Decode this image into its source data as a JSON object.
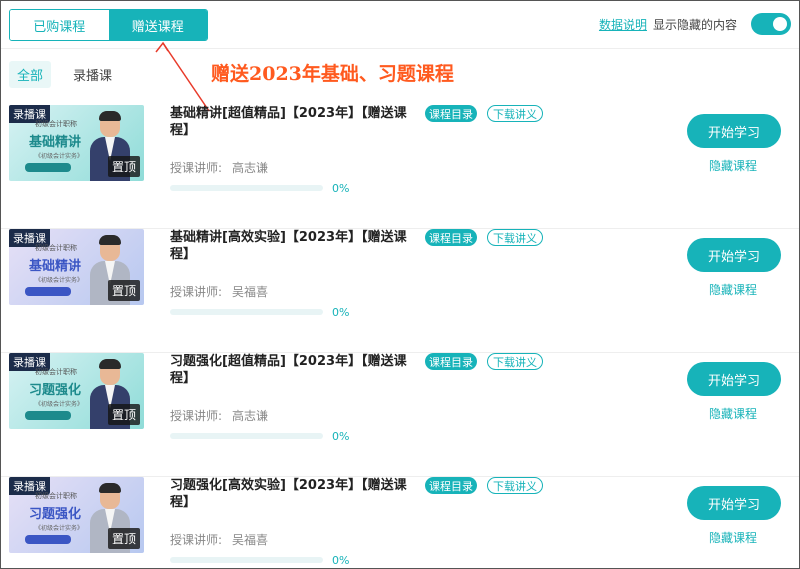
{
  "tabs": [
    {
      "label": "已购课程",
      "active": false
    },
    {
      "label": "赠送课程",
      "active": true
    }
  ],
  "header": {
    "data_link": "数据说明",
    "show_hidden_label": "显示隐藏的内容",
    "toggle_on": true
  },
  "filters": [
    {
      "label": "全部",
      "active": true
    },
    {
      "label": "录播课",
      "active": false
    }
  ],
  "annotation": "赠送2023年基础、习题课程",
  "colors": {
    "accent": "#17b3b9",
    "annotation": "#ff5a1f"
  },
  "courses": [
    {
      "title": "基础精讲[超值精品]【2023年】【赠送课程】",
      "catalog_label": "课程目录",
      "handout_label": "下载讲义",
      "teacher_label": "授课讲师:",
      "teacher_name": "高志谦",
      "progress": 0,
      "progress_text": "0%",
      "start_label": "开始学习",
      "hide_label": "隐藏课程",
      "thumb": {
        "badge": "录播课",
        "subtitle": "初级会计职称",
        "title": "基础精讲",
        "mini": "《初级会计实务》",
        "pin": "置顶",
        "color1": "#d7f2f3",
        "color2": "#8fdcd8",
        "title_color": "#1d8a8c",
        "jacket": "#34406b"
      }
    },
    {
      "title": "基础精讲[高效实验]【2023年】【赠送课程】",
      "catalog_label": "课程目录",
      "handout_label": "下载讲义",
      "teacher_label": "授课讲师:",
      "teacher_name": "吴福喜",
      "progress": 0,
      "progress_text": "0%",
      "start_label": "开始学习",
      "hide_label": "隐藏课程",
      "thumb": {
        "badge": "录播课",
        "subtitle": "初级会计职称",
        "title": "基础精讲",
        "mini": "《初级会计实务》",
        "pin": "置顶",
        "color1": "#e6e0f6",
        "color2": "#b7c8f0",
        "title_color": "#3b56c4",
        "jacket": "#b0b6c4"
      }
    },
    {
      "title": "习题强化[超值精品]【2023年】【赠送课程】",
      "catalog_label": "课程目录",
      "handout_label": "下载讲义",
      "teacher_label": "授课讲师:",
      "teacher_name": "高志谦",
      "progress": 0,
      "progress_text": "0%",
      "start_label": "开始学习",
      "hide_label": "隐藏课程",
      "thumb": {
        "badge": "录播课",
        "subtitle": "初级会计职称",
        "title": "习题强化",
        "mini": "《初级会计实务》",
        "pin": "置顶",
        "color1": "#d7f2f3",
        "color2": "#8fdcd8",
        "title_color": "#1d8a8c",
        "jacket": "#34406b"
      }
    },
    {
      "title": "习题强化[高效实验]【2023年】【赠送课程】",
      "catalog_label": "课程目录",
      "handout_label": "下载讲义",
      "teacher_label": "授课讲师:",
      "teacher_name": "吴福喜",
      "progress": 0,
      "progress_text": "0%",
      "start_label": "开始学习",
      "hide_label": "隐藏课程",
      "thumb": {
        "badge": "录播课",
        "subtitle": "初级会计职称",
        "title": "习题强化",
        "mini": "《初级会计实务》",
        "pin": "置顶",
        "color1": "#e6e0f6",
        "color2": "#b7c8f0",
        "title_color": "#3b56c4",
        "jacket": "#b0b6c4"
      }
    }
  ]
}
